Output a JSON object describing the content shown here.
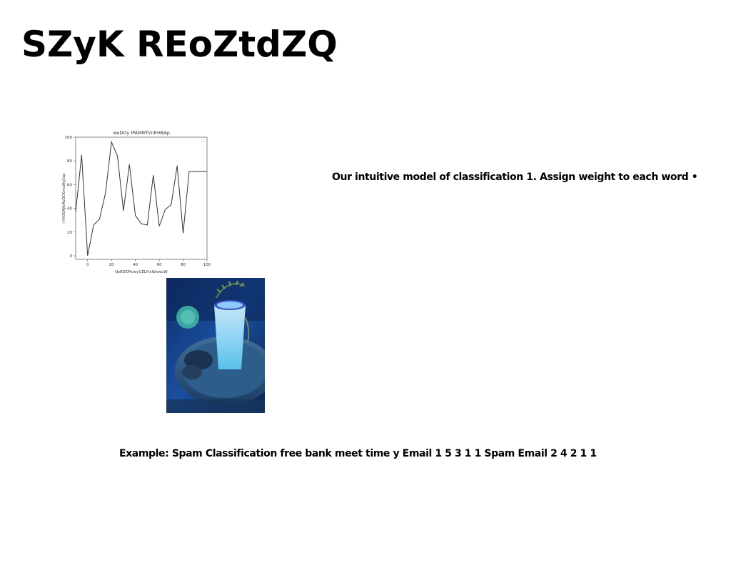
{
  "slide": {
    "title": "SZyK REoZtdZQ",
    "intro_text": "Our intuitive model of classification 1. Assign weight to each word •",
    "example_text": "Example: Spam Classification free bank meet time y Email 1 5 3 1 1 Spam Email 2 4 2 1 1"
  },
  "chart_data": {
    "type": "line",
    "title": "weDDy lPAMlEfVnRHBAp",
    "xlabel": "tJs8DDPcieyCELYtsWxwuW",
    "ylabel": "rjYYODAJfpRuOCKmuWyjSqx",
    "xlim": [
      -10,
      100
    ],
    "ylim": [
      -3,
      100
    ],
    "xticks": [
      0,
      20,
      40,
      60,
      80,
      100
    ],
    "yticks": [
      0,
      20,
      40,
      60,
      80,
      100
    ],
    "legend_position": "top-right",
    "grid": false,
    "line_color": "#333333",
    "series": [
      {
        "x": [
          -10,
          -5,
          0,
          5,
          10,
          15,
          20,
          25,
          30,
          35,
          40,
          45,
          50,
          55,
          60,
          65,
          70,
          75,
          80,
          85,
          90,
          95,
          100
        ],
        "values": [
          37,
          85,
          0,
          26,
          31,
          53,
          96,
          84,
          38,
          77,
          34,
          27,
          26,
          68,
          25,
          39,
          43,
          76,
          19,
          71,
          71,
          71,
          71
        ]
      }
    ]
  },
  "photo": {
    "description_icon": "drink-photo"
  }
}
